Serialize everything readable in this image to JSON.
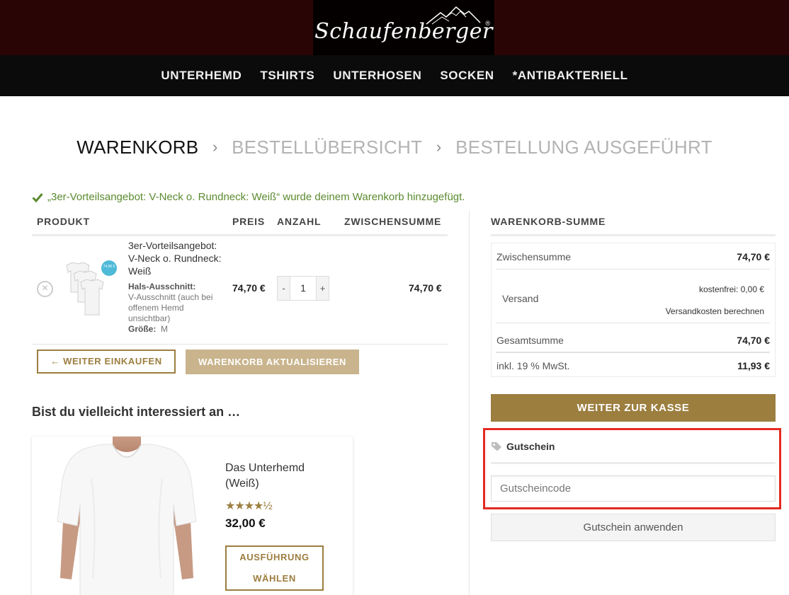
{
  "header": {
    "logo_text": "Schaufenberger",
    "logo_reg": "®",
    "nav": [
      "UNTERHEMD",
      "TSHIRTS",
      "UNTERHOSEN",
      "SOCKEN",
      "*ANTIBAKTERIELL"
    ]
  },
  "steps": {
    "active": "WARENKORB",
    "second": "BESTELLÜBERSICHT",
    "third": "BESTELLUNG AUSGEFÜHRT",
    "separator": "›"
  },
  "notice": "„3er-Vorteilsangebot: V-Neck o. Rundneck: Weiß“ wurde deinem Warenkorb hinzugefügt.",
  "cart": {
    "headers": {
      "product": "PRODUKT",
      "price": "PREIS",
      "quantity": "ANZAHL",
      "subtotal": "ZWISCHENSUMME"
    },
    "item": {
      "remove": "×",
      "name": "3er-Vorteilsangebot: V-Neck o. Rundneck: Weiß",
      "attr1_label": "Hals-Ausschnitt:",
      "attr1_value": "V-Ausschnitt (auch bei offenem Hemd unsichtbar)",
      "attr2_label": "Größe:",
      "attr2_value": "M",
      "price": "74,70 €",
      "qty_minus": "-",
      "qty": "1",
      "qty_plus": "+",
      "subtotal": "74,70 €",
      "badge_text": "74,90 €"
    },
    "continue_label": "← WEITER EINKAUFEN",
    "update_label": "WARENKORB AKTUALISIEREN"
  },
  "cross_sell": {
    "title": "Bist du vielleicht interessiert an …",
    "product": {
      "name": "Das Unterhemd (Weiß)",
      "rating": 4.5,
      "stars": "★★★★½",
      "price": "32,00 €",
      "button": "AUSFÜHRUNG WÄHLEN"
    }
  },
  "totals": {
    "title": "WARENKORB-SUMME",
    "subtotal_label": "Zwischensumme",
    "subtotal_value": "74,70 €",
    "shipping_label": "Versand",
    "shipping_value": "kostenfrei: 0,00 €",
    "shipping_calc": "Versandkosten berechnen",
    "total_label": "Gesamtsumme",
    "total_value": "74,70 €",
    "tax_label": "inkl. 19 % MwSt.",
    "tax_value": "11,93 €",
    "checkout_label": "WEITER ZUR KASSE"
  },
  "coupon": {
    "title": "Gutschein",
    "placeholder": "Gutscheincode",
    "apply_label": "Gutschein anwenden"
  },
  "colors": {
    "accent": "#9c7e3f",
    "accent_light": "#c9b48d",
    "header_bg": "#2a0505",
    "nav_bg": "#0b0b0b",
    "success": "#5b8a2f",
    "highlight": "#e32a22"
  }
}
